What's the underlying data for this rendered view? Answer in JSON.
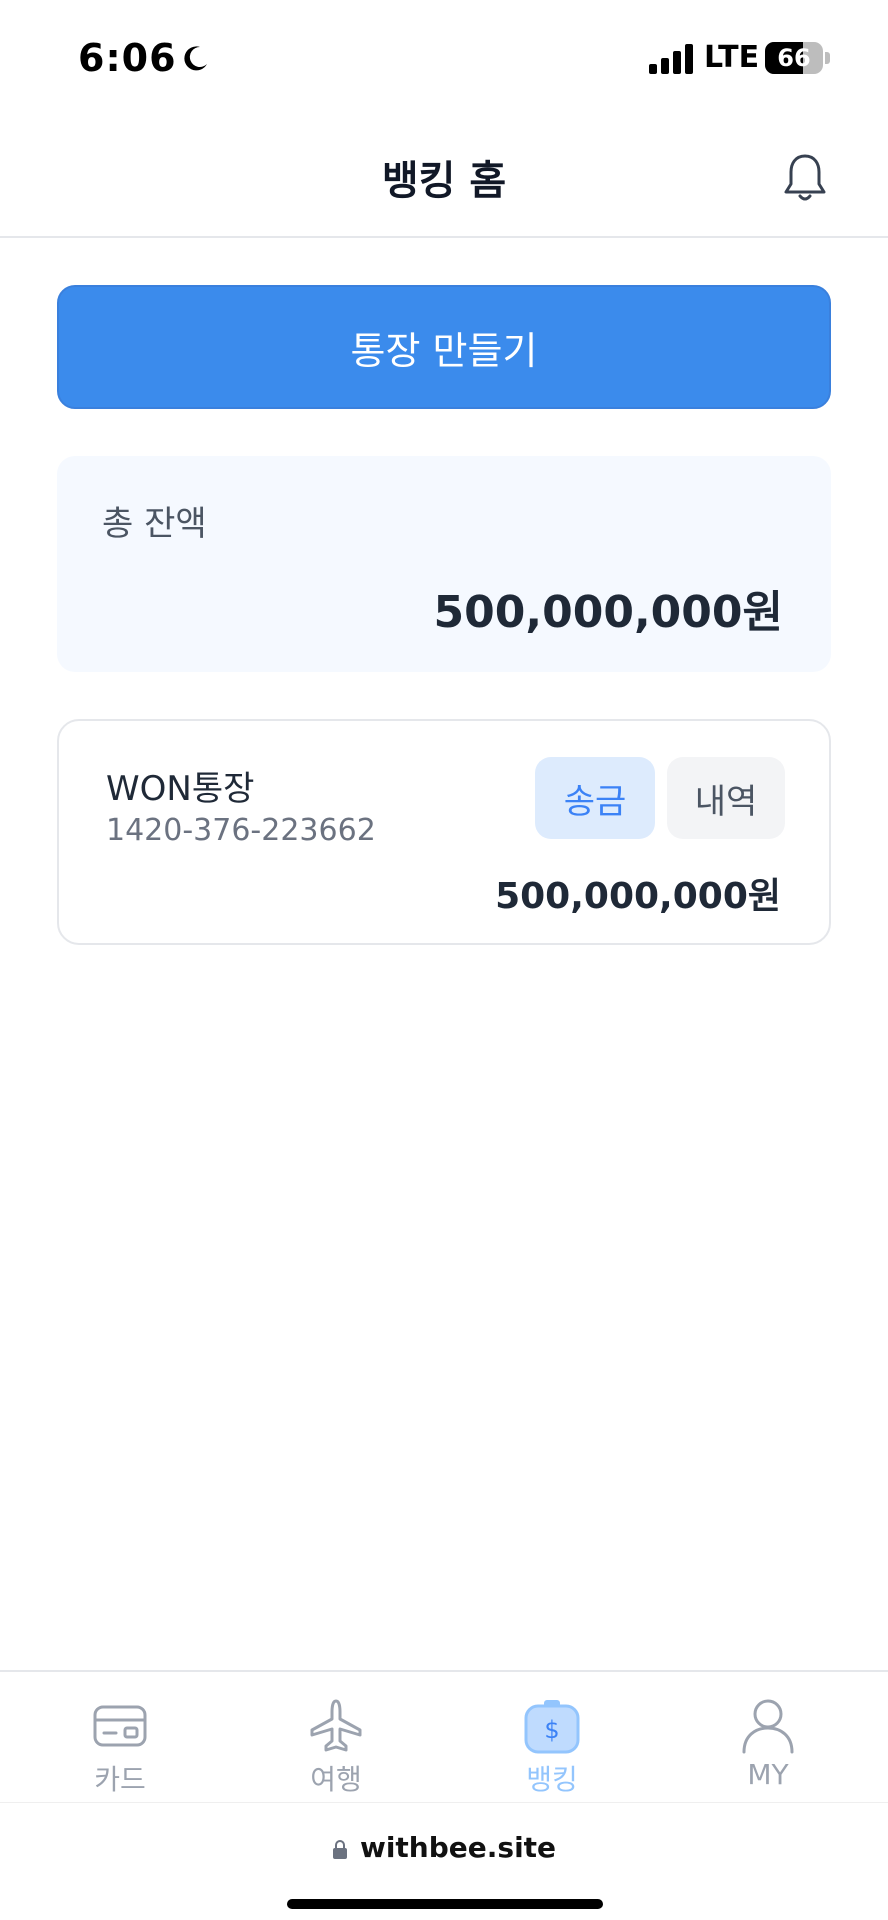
{
  "status_bar": {
    "time": "6:06",
    "network": "LTE",
    "battery_percent": "66",
    "battery_level": 0.66
  },
  "header": {
    "title": "뱅킹 홈",
    "bell_icon": "bell-icon"
  },
  "create_account": {
    "label": "통장 만들기",
    "color": "#3b8bec"
  },
  "total_balance": {
    "label": "총 잔액",
    "amount": "500,000,000원"
  },
  "accounts": [
    {
      "name": "WON통장",
      "number": "1420-376-223662",
      "balance": "500,000,000원",
      "send_label": "송금",
      "history_label": "내역"
    }
  ],
  "bottom_nav": {
    "items": [
      {
        "label": "카드",
        "icon": "card-icon",
        "active": false
      },
      {
        "label": "여행",
        "icon": "airplane-icon",
        "active": false
      },
      {
        "label": "뱅킹",
        "icon": "money-bag-icon",
        "active": true
      },
      {
        "label": "MY",
        "icon": "user-icon",
        "active": false
      }
    ],
    "active_color": "#93c5fd",
    "inactive_color": "#9ca3af"
  },
  "browser": {
    "url": "withbee.site"
  }
}
